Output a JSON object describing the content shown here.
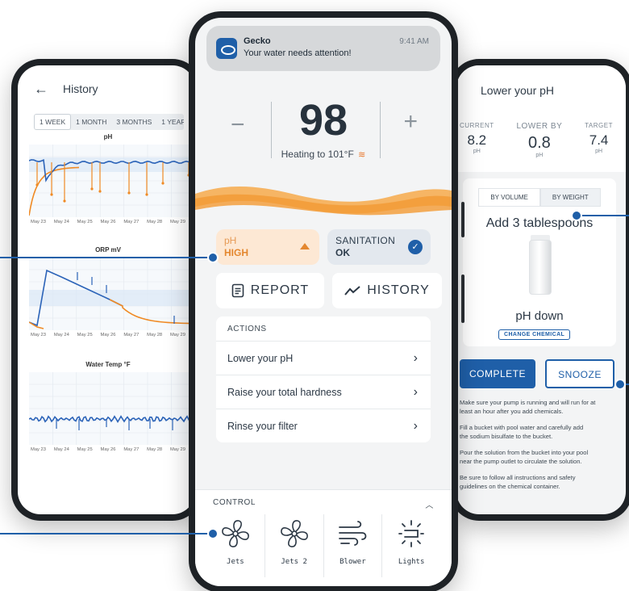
{
  "history_screen": {
    "title": "History",
    "ranges": [
      "1 WEEK",
      "1 MONTH",
      "3 MONTHS",
      "1 YEAR"
    ],
    "selected_range": "1 WEEK",
    "charts": [
      {
        "title": "pH"
      },
      {
        "title": "ORP mV"
      },
      {
        "title": "Water Temp °F"
      }
    ],
    "x_labels": [
      "May 23",
      "May 24",
      "May 25",
      "May 26",
      "May 27",
      "May 28",
      "May 29"
    ]
  },
  "main_screen": {
    "notification": {
      "app": "Gecko",
      "message": "Your water needs attention!",
      "time": "9:41 AM"
    },
    "temperature": {
      "minus": "−",
      "plus": "+",
      "value": "98",
      "status": "Heating to 101°F",
      "heat_icon": "≋"
    },
    "ph_chip": {
      "label": "pH",
      "value": "HIGH"
    },
    "sanitation_chip": {
      "label": "SANITATION",
      "value": "OK",
      "check": "✓"
    },
    "report_button": "REPORT",
    "history_button": "HISTORY",
    "actions": {
      "header": "ACTIONS",
      "items": [
        "Lower your pH",
        "Raise your total hardness",
        "Rinse your filter"
      ]
    },
    "control": {
      "header": "CONTROL",
      "items": [
        {
          "label": "Jets",
          "icon": "fan-icon"
        },
        {
          "label": "Jets 2",
          "icon": "fan-icon"
        },
        {
          "label": "Blower",
          "icon": "wind-icon"
        },
        {
          "label": "Lights",
          "icon": "light-icon"
        }
      ]
    }
  },
  "lower_ph_screen": {
    "title": "Lower your pH",
    "current": {
      "label": "CURRENT",
      "value": "8.2",
      "unit": "pH"
    },
    "lower_by": {
      "label": "LOWER BY",
      "value": "0.8",
      "unit": "pH"
    },
    "target": {
      "label": "TARGET",
      "value": "7.4",
      "unit": "pH"
    },
    "tabs": [
      "BY VOLUME",
      "BY WEIGHT"
    ],
    "dose": "Add 3 tablespoons",
    "chemical": "pH down",
    "change_chemical": "CHANGE CHEMICAL",
    "complete_button": "COMPLETE",
    "snooze_button": "SNOOZE",
    "instructions": [
      "Make sure your pump is running and will run for at",
      "least an hour after you add chemicals.",
      "Fill a bucket with pool water and carefully add",
      "the sodium bisulfate to the bucket.",
      "Pour the solution from the bucket into your pool",
      "near the pump outlet to circulate the solution.",
      "Be sure to follow all instructions and safety",
      "guidelines on the chemical container."
    ]
  },
  "colors": {
    "brand_blue": "#1f5fa8",
    "alert_orange": "#e4872f",
    "series_orange": "#f08a24",
    "series_blue": "#2b63b8"
  }
}
